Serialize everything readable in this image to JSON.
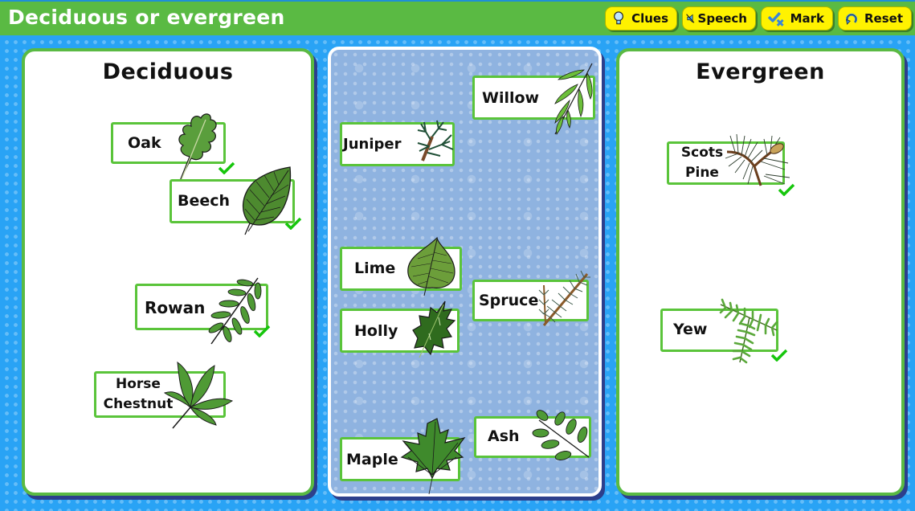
{
  "app": {
    "title": "Deciduous or evergreen"
  },
  "toolbar": {
    "buttons": [
      {
        "id": "clues",
        "label": "Clues",
        "icon": "lightbulb-icon"
      },
      {
        "id": "speech",
        "label": "Speech",
        "icon": "speaker-muted-icon"
      },
      {
        "id": "mark",
        "label": "Mark",
        "icon": "check-cross-icon"
      },
      {
        "id": "reset",
        "label": "Reset",
        "icon": "reset-arrow-icon"
      }
    ]
  },
  "colors": {
    "header_green": "#5aba43",
    "button_yellow": "#fff200",
    "background_blue": "#29a3f5",
    "card_border_green": "#5ac43a",
    "pool_blue": "#8fb3e0",
    "check_green": "#16c60c"
  },
  "panels": {
    "deciduous": {
      "title": "Deciduous",
      "cards": [
        {
          "label": "Oak",
          "leaf": "oak-leaf-icon",
          "correct": true
        },
        {
          "label": "Beech",
          "leaf": "beech-leaf-icon",
          "correct": true
        },
        {
          "label": "Rowan",
          "leaf": "rowan-leaf-icon",
          "correct": true
        },
        {
          "label_line1": "Horse",
          "label_line2": "Chestnut",
          "leaf": "horse-chestnut-leaf-icon",
          "correct": null
        }
      ]
    },
    "pool": {
      "cards": [
        {
          "label": "Willow",
          "leaf": "willow-leaf-icon"
        },
        {
          "label": "Juniper",
          "leaf": "juniper-sprig-icon"
        },
        {
          "label": "Lime",
          "leaf": "lime-leaf-icon"
        },
        {
          "label": "Spruce",
          "leaf": "spruce-sprig-icon"
        },
        {
          "label": "Holly",
          "leaf": "holly-leaf-icon"
        },
        {
          "label": "Ash",
          "leaf": "ash-leaf-icon"
        },
        {
          "label": "Maple",
          "leaf": "maple-leaf-icon"
        }
      ]
    },
    "evergreen": {
      "title": "Evergreen",
      "cards": [
        {
          "label_line1": "Scots",
          "label_line2": "Pine",
          "leaf": "scots-pine-sprig-icon",
          "correct": true
        },
        {
          "label": "Yew",
          "leaf": "yew-sprig-icon",
          "correct": true
        }
      ]
    }
  }
}
